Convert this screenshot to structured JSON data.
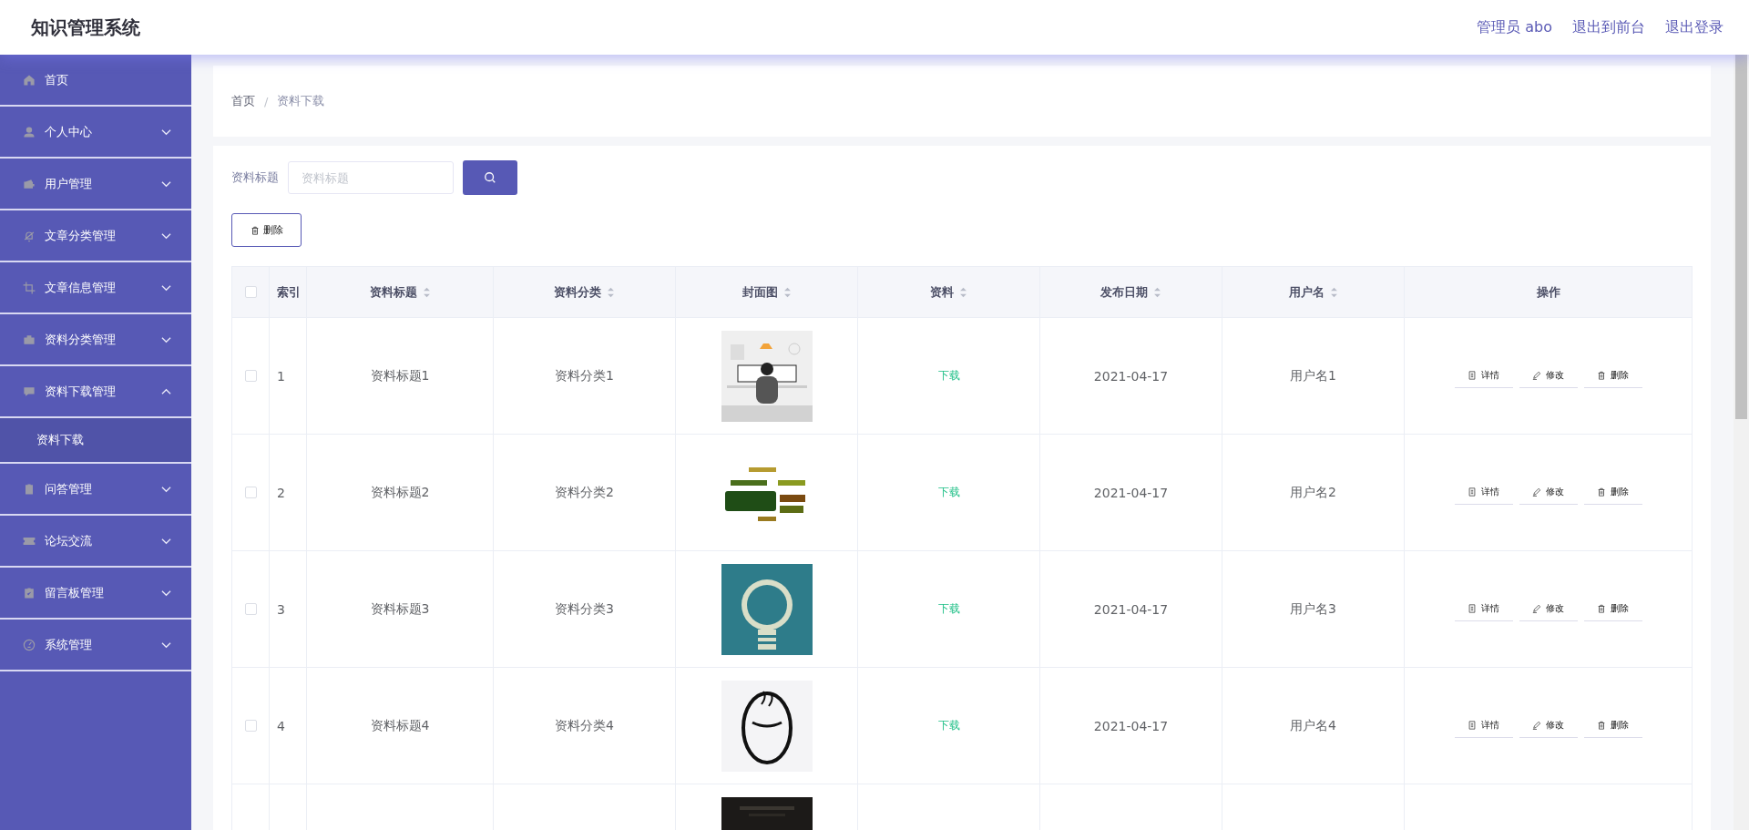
{
  "header": {
    "title": "知识管理系统",
    "links": [
      "管理员 abo",
      "退出到前台",
      "退出登录"
    ]
  },
  "sidebar": {
    "items": [
      {
        "kind": "link",
        "label": "首页"
      },
      {
        "kind": "group",
        "label": "个人中心",
        "expanded": false
      },
      {
        "kind": "group",
        "label": "用户管理",
        "expanded": false
      },
      {
        "kind": "group",
        "label": "文章分类管理",
        "expanded": false
      },
      {
        "kind": "group",
        "label": "文章信息管理",
        "expanded": false
      },
      {
        "kind": "group",
        "label": "资料分类管理",
        "expanded": false
      },
      {
        "kind": "group",
        "label": "资料下载管理",
        "expanded": true,
        "children": [
          {
            "label": "资料下载",
            "selected": true
          }
        ]
      },
      {
        "kind": "group",
        "label": "问答管理",
        "expanded": false
      },
      {
        "kind": "group",
        "label": "论坛交流",
        "expanded": false
      },
      {
        "kind": "group",
        "label": "留言板管理",
        "expanded": false
      },
      {
        "kind": "group",
        "label": "系统管理",
        "expanded": false
      }
    ]
  },
  "breadcrumb": [
    "首页",
    "/",
    "资料下载"
  ],
  "search": {
    "label": "资料标题",
    "placeholder": "资料标题"
  },
  "delete_button": "删除",
  "table": {
    "select_all_checked": false,
    "columns": [
      {
        "label": "索引",
        "kind": "plain"
      },
      {
        "label": "资料标题",
        "kind": "sortable"
      },
      {
        "label": "资料分类",
        "kind": "sortable"
      },
      {
        "label": "封面图",
        "kind": "sortable"
      },
      {
        "label": "资料",
        "kind": "sortable"
      },
      {
        "label": "发布日期",
        "kind": "sortable"
      },
      {
        "label": "用户名",
        "kind": "sortable"
      },
      {
        "label": "操作",
        "kind": "plain"
      }
    ],
    "rows": [
      {
        "kind": "full",
        "checked": false,
        "index": "1",
        "title": "资料标题1",
        "category": "资料分类1",
        "file": "下载",
        "date": "2021-04-17",
        "user": "用户名1",
        "actions": [
          "详情",
          "修改",
          "删除"
        ]
      },
      {
        "kind": "full",
        "checked": false,
        "index": "2",
        "title": "资料标题2",
        "category": "资料分类2",
        "file": "下载",
        "date": "2021-04-17",
        "user": "用户名2",
        "actions": [
          "详情",
          "修改",
          "删除"
        ]
      },
      {
        "kind": "full",
        "checked": false,
        "index": "3",
        "title": "资料标题3",
        "category": "资料分类3",
        "file": "下载",
        "date": "2021-04-17",
        "user": "用户名3",
        "actions": [
          "详情",
          "修改",
          "删除"
        ]
      },
      {
        "kind": "full",
        "checked": false,
        "index": "4",
        "title": "资料标题4",
        "category": "资料分类4",
        "file": "下载",
        "date": "2021-04-17",
        "user": "用户名4",
        "actions": [
          "详情",
          "修改",
          "删除"
        ]
      },
      {
        "kind": "partial"
      }
    ]
  }
}
